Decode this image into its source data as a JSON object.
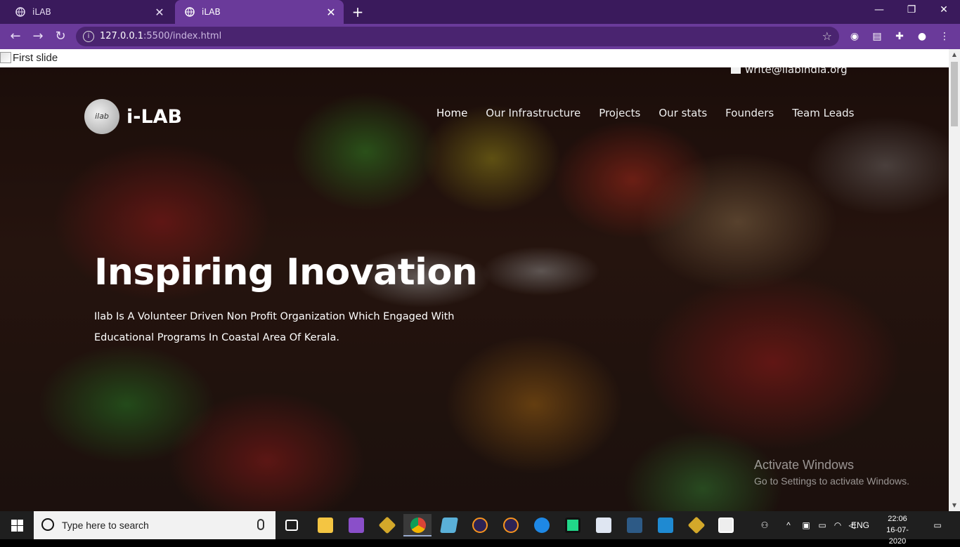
{
  "browser": {
    "tabs": [
      {
        "title": "iLAB",
        "active": false
      },
      {
        "title": "iLAB",
        "active": true
      }
    ],
    "url_host": "127.0.0.1",
    "url_path": ":5500/index.html",
    "new_tab": "+",
    "window_controls": {
      "minimize": "—",
      "restore": "❐",
      "close": "✕"
    }
  },
  "page": {
    "broken_image_alt": "First slide",
    "contact_email": "write@ilabindia.org",
    "brand": {
      "logo_text": "ilab",
      "name": "i-LAB"
    },
    "nav": [
      {
        "label": "Home",
        "active": true
      },
      {
        "label": "Our Infrastructure"
      },
      {
        "label": "Projects"
      },
      {
        "label": "Our stats"
      },
      {
        "label": "Founders"
      },
      {
        "label": "Team Leads"
      }
    ],
    "hero": {
      "title": "Inspiring Inovation",
      "text": "Ilab Is A Volunteer Driven Non Profit Organization Which Engaged With Educational Programs In Coastal Area Of Kerala."
    },
    "watermark": {
      "line1": "Activate Windows",
      "line2": "Go to Settings to activate Windows."
    }
  },
  "taskbar": {
    "search_placeholder": "Type here to search",
    "tray_language": "ENG",
    "time": "22:06",
    "date": "16-07-2020"
  },
  "colors": {
    "tab_bar": "#3a1a5c",
    "toolbar": "#6a3a9a",
    "taskbar": "#1f1f1f"
  }
}
